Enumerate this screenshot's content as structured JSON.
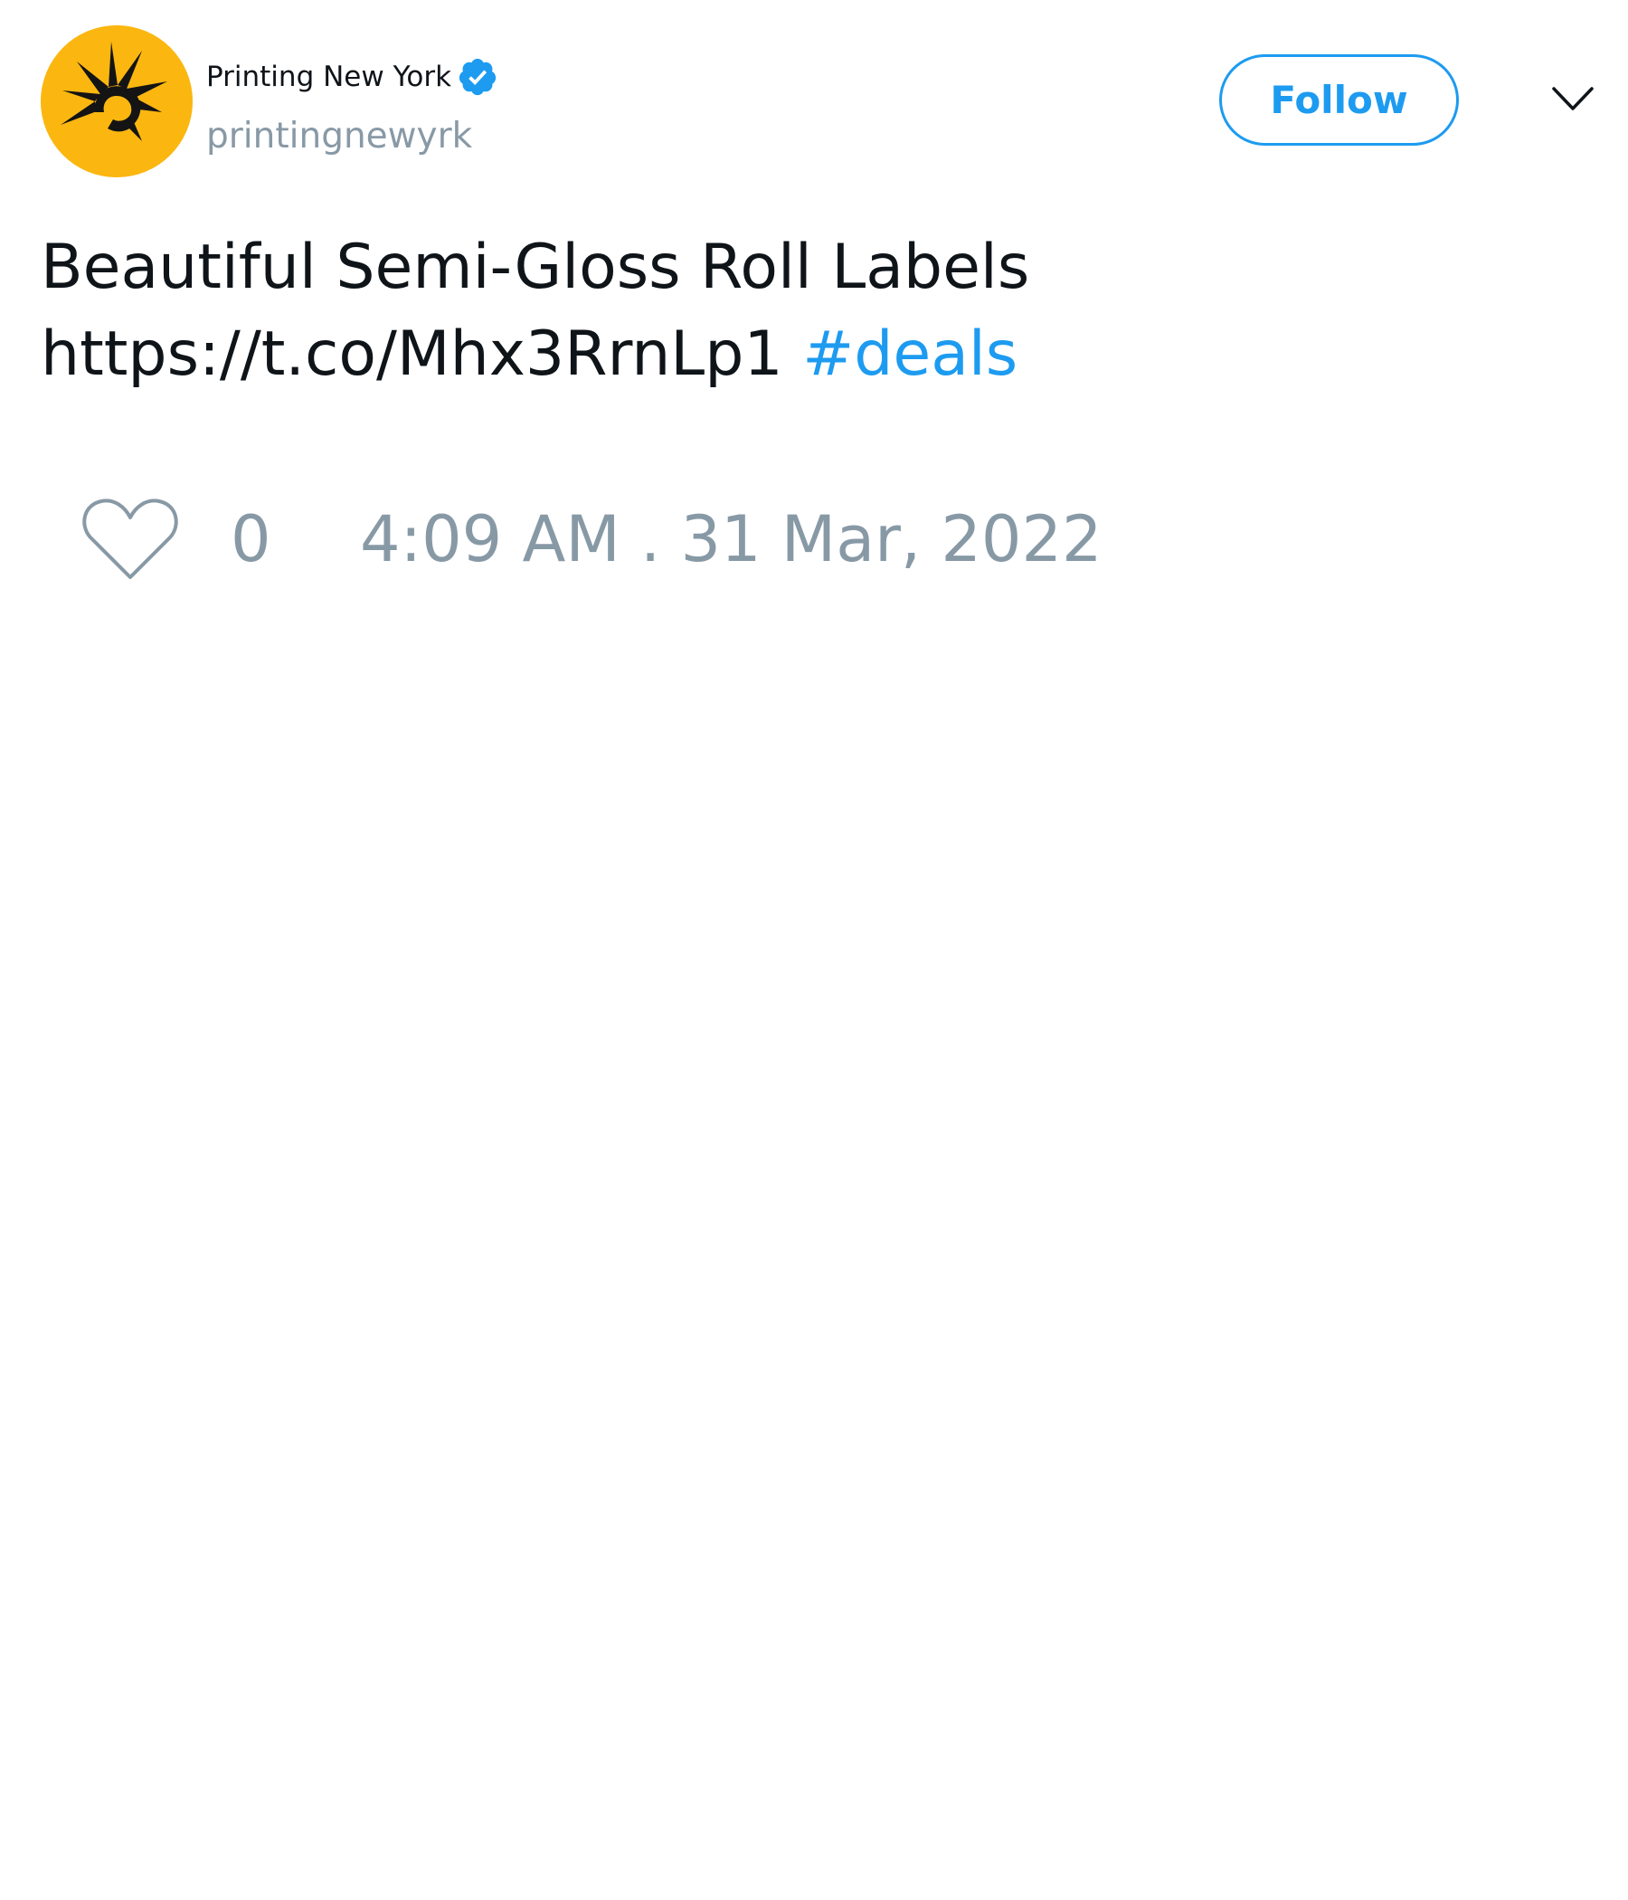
{
  "account": {
    "display_name": "Printing New York",
    "handle": "printingnewyrk",
    "verified": true,
    "avatar_icon": "sunburst-logo-icon",
    "avatar_bg_color": "#fbb710"
  },
  "header": {
    "follow_label": "Follow",
    "menu_icon": "chevron-down-icon"
  },
  "tweet": {
    "text_line1": "Beautiful Semi-Gloss Roll Labels",
    "link": "https://t.co/Mhx3RrnLp1",
    "hashtag": "#deals"
  },
  "footer": {
    "like_icon": "heart-icon",
    "like_count": "0",
    "timestamp": "4:09 AM . 31 Mar, 2022"
  },
  "colors": {
    "accent": "#1d9bf0",
    "muted": "#8899a6",
    "text": "#0f1419"
  }
}
